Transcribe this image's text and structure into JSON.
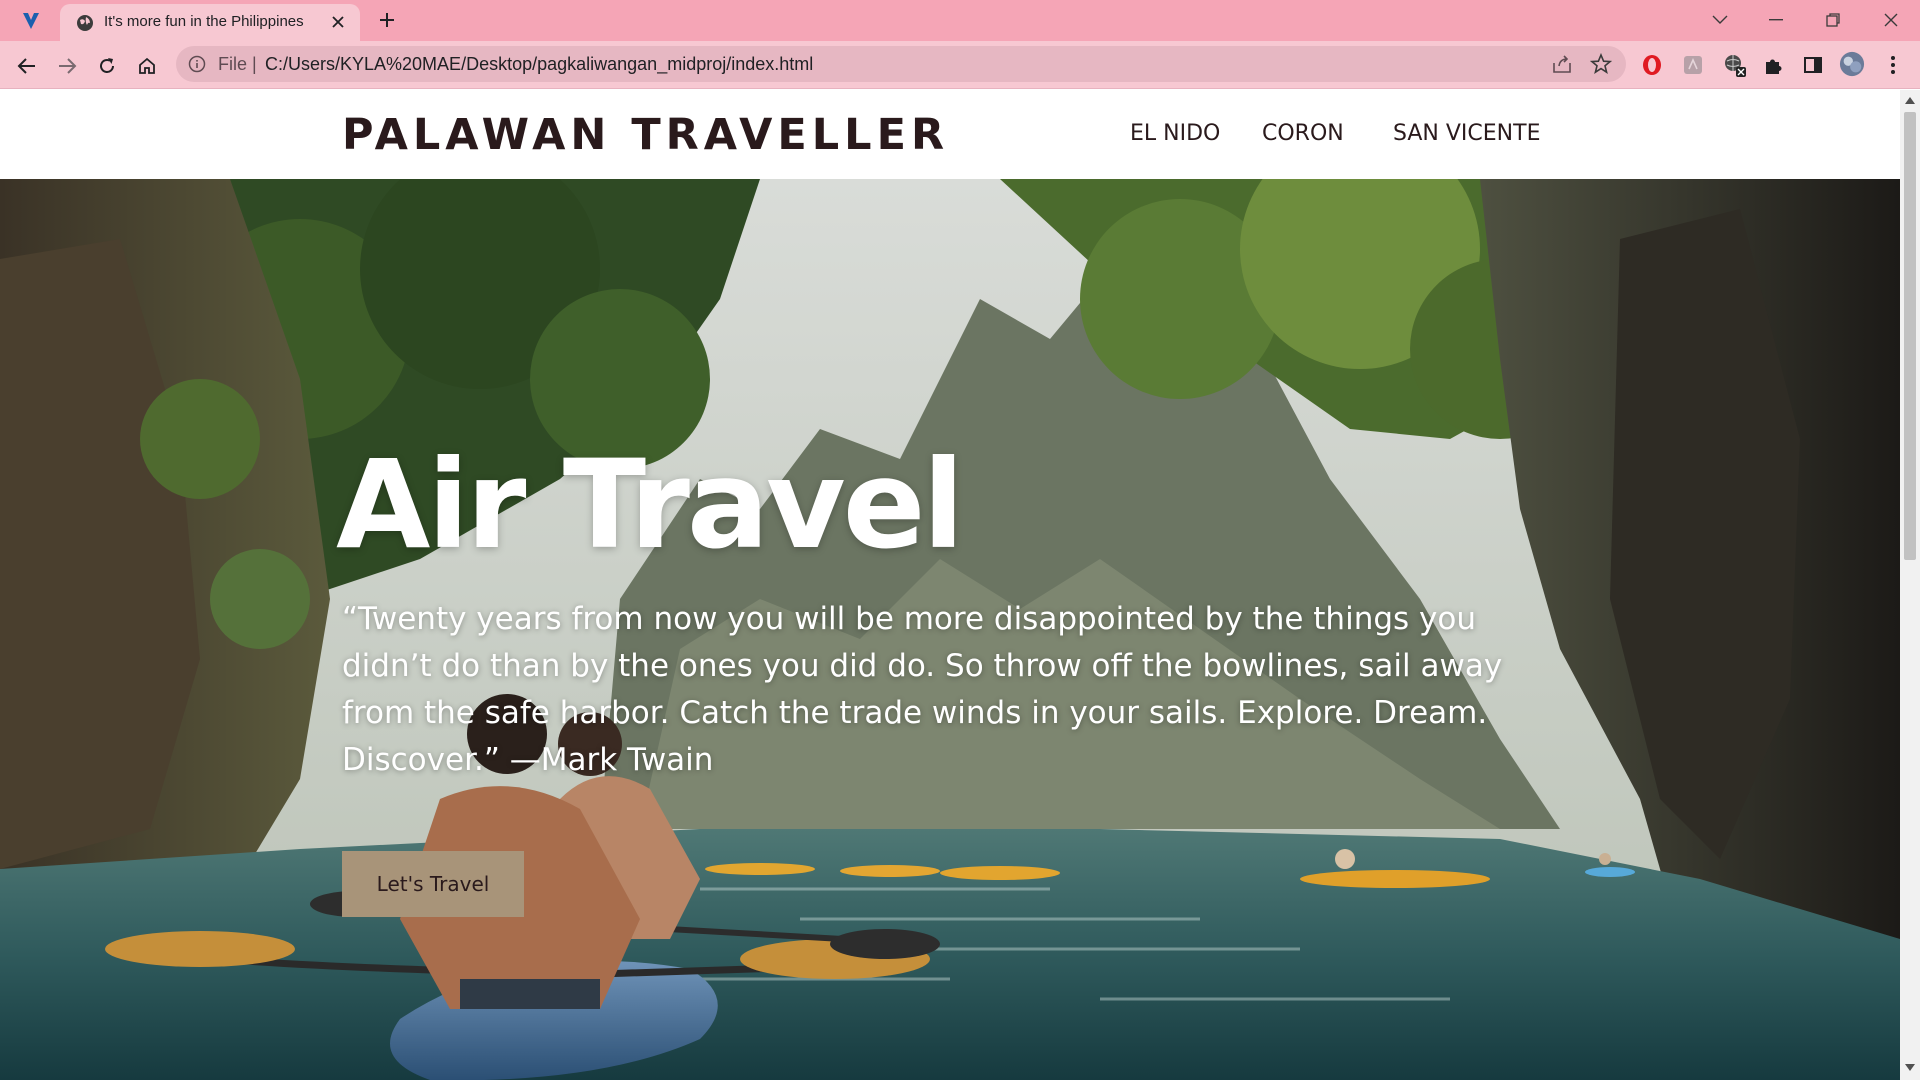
{
  "browser": {
    "tab_title": "It's more fun in the Philippines",
    "address_scheme": "File",
    "address_separator": "|",
    "url": "C:/Users/KYLA%20MAE/Desktop/pagkaliwangan_midproj/index.html",
    "icons": {
      "tab_search": "tab-search-icon",
      "favicon": "globe-icon",
      "close": "close-icon",
      "new_tab": "plus-icon",
      "back": "arrow-left-icon",
      "forward": "arrow-right-icon",
      "reload": "reload-icon",
      "home": "home-icon",
      "info": "info-icon",
      "share": "share-icon",
      "bookmark": "star-icon",
      "extensions": [
        "opera-icon",
        "pdf-extension-icon",
        "translate-extension-icon",
        "puzzle-icon",
        "side-panel-icon",
        "profile-avatar-icon",
        "kebab-menu-icon"
      ]
    },
    "colors": {
      "tabbar": "#f5a5b6",
      "toolbar": "#f7c8d2",
      "omnibox": "#e6b7c2"
    }
  },
  "site": {
    "brand": "PALAWAN TRAVELLER",
    "nav": [
      "EL NIDO",
      "CORON",
      "SAN VICENTE"
    ],
    "hero": {
      "title": "Air Travel",
      "quote": "“Twenty years from now you will be more disappointed by the things you didn’t do than by the ones you did do. So throw off the bowlines, sail away from the safe harbor. Catch the trade winds in your sails. Explore. Dream. Discover.” —Mark Twain",
      "cta": "Let's Travel"
    },
    "colors": {
      "cta_bg": "#a89479",
      "text_dark": "#2a1a1c"
    }
  }
}
